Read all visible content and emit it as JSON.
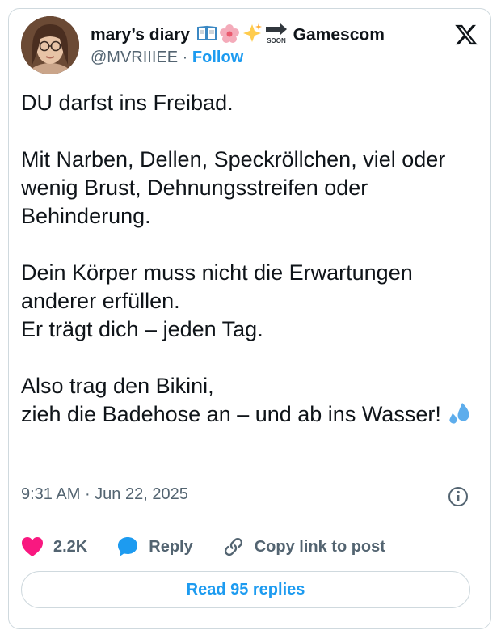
{
  "author": {
    "display_name": "mary’s diary",
    "name_emojis": [
      "open-book-emoji",
      "blossom-emoji",
      "sparkles-emoji",
      "soon-arrow-emoji"
    ],
    "soon_label": "SOON",
    "name_suffix": "Gamescom",
    "handle": "@MVRIIIEE",
    "separator": " · ",
    "follow_label": "Follow"
  },
  "platform_icon": "x-logo-icon",
  "tweet": {
    "text": "DU darfst ins Freibad.\n\nMit Narben, Dellen, Speckröllchen, viel oder wenig Brust, Dehnungsstreifen oder Behinderung.\n\nDein Körper muss nicht die Erwartungen anderer erfüllen.\nEr trägt dich – jeden Tag.\n\nAlso trag den Bikini,\nzieh die Badehose an – und ab ins Wasser! ",
    "trailing_icon": "sweat-droplets-emoji",
    "time": "9:31 AM",
    "date_separator": " · ",
    "date": "Jun 22, 2025"
  },
  "actions": {
    "likes": "2.2K",
    "reply_label": "Reply",
    "copy_label": "Copy link to post"
  },
  "read_replies_label": "Read 95 replies",
  "colors": {
    "accent": "#1d9bf0",
    "like": "#f91880",
    "text": "#0f1419",
    "muted": "#536471",
    "border": "#cfd9de"
  }
}
